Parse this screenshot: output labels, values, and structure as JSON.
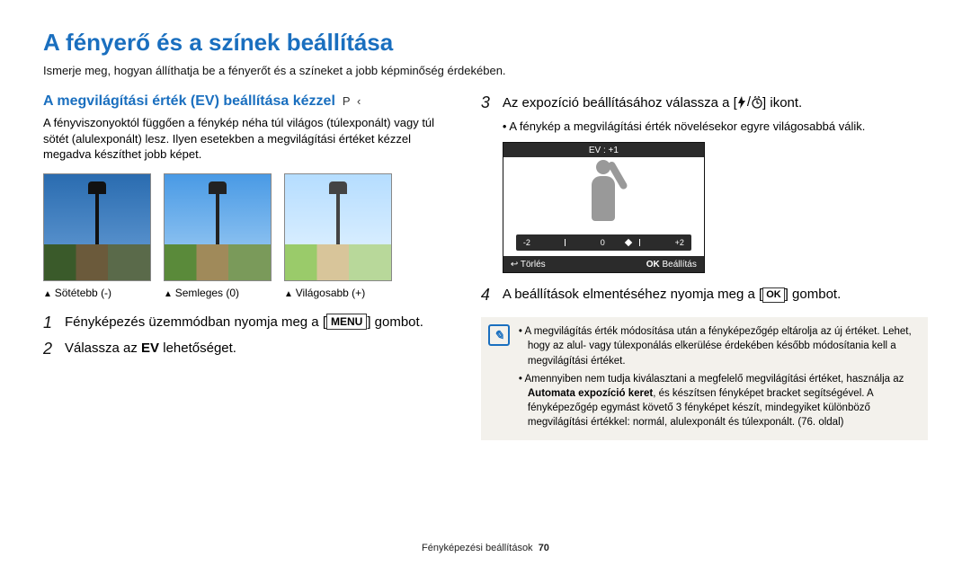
{
  "page": {
    "title": "A fényerő és a színek beállítása",
    "subtitle": "Ismerje meg, hogyan állíthatja be a fényerőt és a színeket a jobb képminőség érdekében."
  },
  "left": {
    "heading": "A megvilágítási érték (EV) beállítása kézzel",
    "modes": "P  ‹",
    "intro": "A fényviszonyoktól függően a fénykép néha túl világos (túlexponált) vagy túl sötét (alulexponált) lesz. Ilyen esetekben a megvilágítási értéket kézzel megadva készíthet jobb képet.",
    "thumbs": [
      {
        "caption": "Sötétebb (-)"
      },
      {
        "caption": "Semleges (0)"
      },
      {
        "caption": "Világosabb (+)"
      }
    ],
    "step1_a": "Fényképezés üzemmódban nyomja meg a [",
    "step1_btn": "MENU",
    "step1_b": "] gombot.",
    "step2": "Válassza az ",
    "step2_bold": "EV",
    "step2_b": " lehetőséget."
  },
  "right": {
    "step3_a": "Az expozíció beállításához válassza a [",
    "step3_b": "] ikont.",
    "step3_bullet": "A fénykép a megvilágítási érték növelésekor egyre világosabbá válik.",
    "lcd": {
      "ev_label": "EV : +1",
      "minus": "-2",
      "zero": "0",
      "plus": "+2",
      "cancel_icon": "↩",
      "cancel": "Törlés",
      "ok_icon": "OK",
      "ok": "Beállítás"
    },
    "step4_a": "A beállítások elmentéséhez nyomja meg a [",
    "step4_btn": "OK",
    "step4_b": "] gombot.",
    "note": {
      "item1": "A megvilágítás érték módosítása után a fényképezőgép eltárolja az új értéket. Lehet, hogy az alul- vagy túlexponálás elkerülése érdekében később módosítania kell a megvilágítási értéket.",
      "item2_a": "Amennyiben nem tudja kiválasztani a megfelelő megvilágítási értéket, használja az ",
      "item2_bold": "Automata expozíció keret",
      "item2_b": ", és készítsen fényképet bracket segítségével. A fényképezőgép egymást követő 3 fényképet készít, mindegyiket különböző megvilágítási értékkel: normál, alulexponált és túlexponált. (76. oldal)"
    }
  },
  "footer": {
    "section": "Fényképezési beállítások",
    "page_no": "70"
  }
}
